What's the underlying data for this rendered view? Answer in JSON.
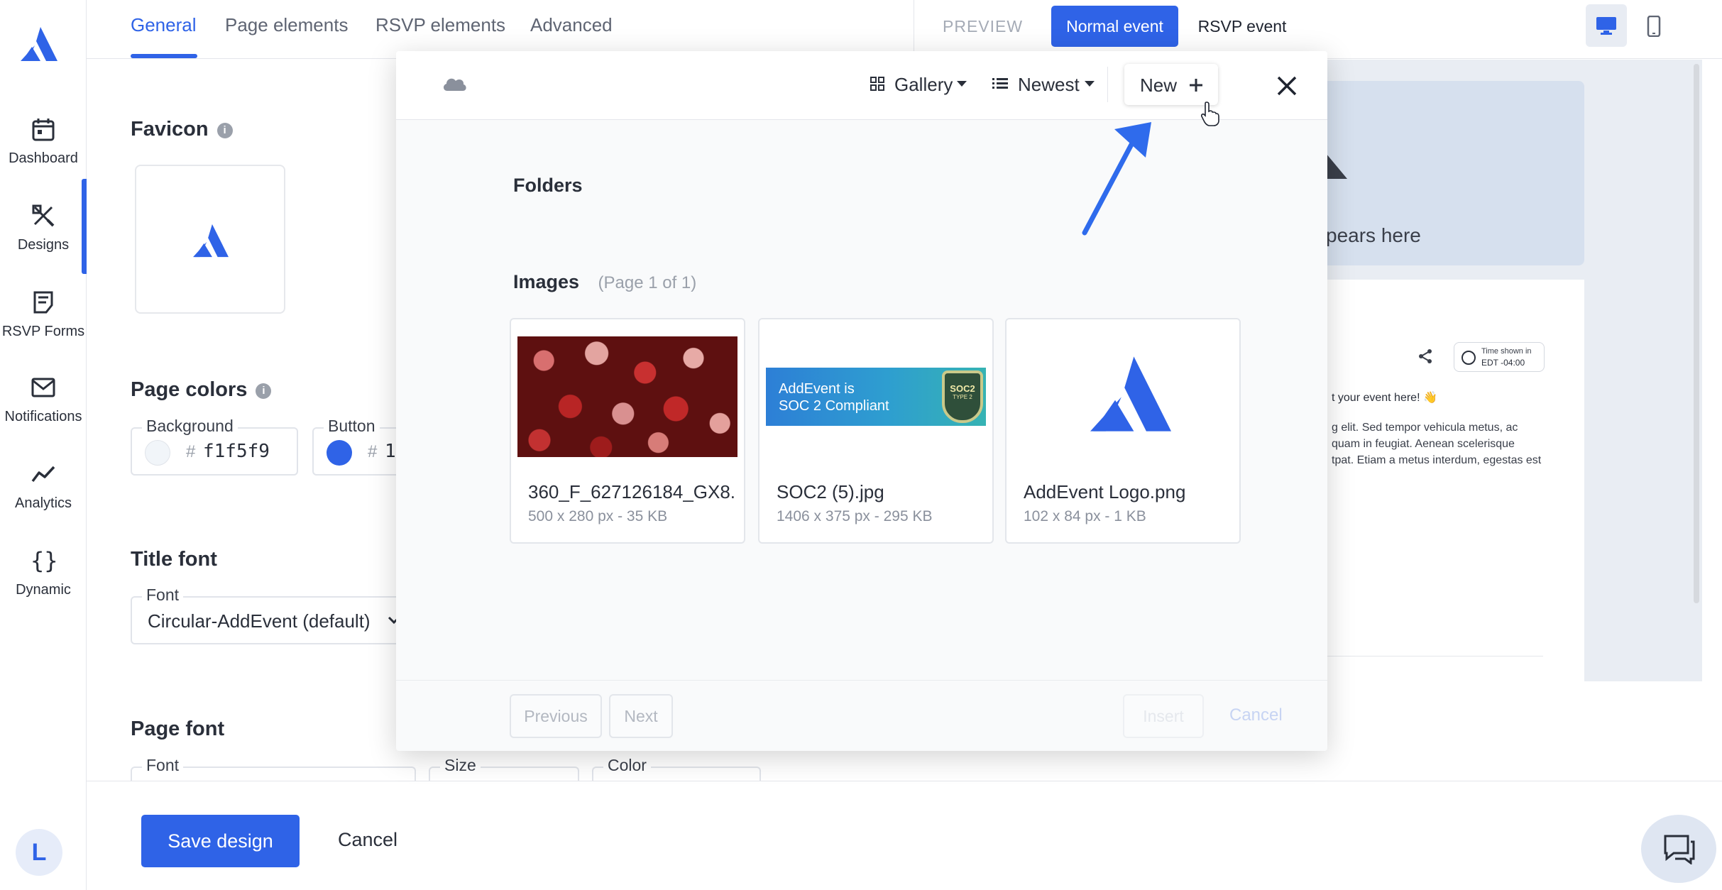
{
  "sidebar": {
    "items": [
      {
        "label": "Dashboard",
        "icon": "calendar-icon"
      },
      {
        "label": "Designs",
        "icon": "design-tools-icon"
      },
      {
        "label": "RSVP Forms",
        "icon": "form-icon"
      },
      {
        "label": "Notifications",
        "icon": "mail-icon"
      },
      {
        "label": "Analytics",
        "icon": "chart-line-icon"
      },
      {
        "label": "Dynamic",
        "icon": "braces-icon"
      }
    ],
    "avatar_initial": "L"
  },
  "tabs": [
    "General",
    "Page elements",
    "RSVP elements",
    "Advanced"
  ],
  "preview": {
    "label": "PREVIEW",
    "normal_event": "Normal event",
    "rsvp_event": "RSVP event",
    "hero_text": "pears here",
    "timezone_line1": "Time shown in",
    "timezone_line2": "EDT -04:00",
    "body_line1": "t your event here! 👋",
    "body_lines": [
      "g elit. Sed tempor vehicula metus, ac",
      "quam in feugiat. Aenean scelerisque",
      "tpat. Etiam a metus interdum, egestas est"
    ]
  },
  "form": {
    "favicon_title": "Favicon",
    "page_colors_title": "Page colors",
    "background_label": "Background",
    "background_hash": "#",
    "background_value": "f1f5f9",
    "button_label": "Button",
    "button_hash": "#",
    "button_value": "1",
    "title_font_title": "Title font",
    "title_font_label": "Font",
    "title_font_value": "Circular-AddEvent (default)",
    "page_font_title": "Page font",
    "page_font_label": "Font",
    "size_label": "Size",
    "color_label": "Color"
  },
  "footer": {
    "save_label": "Save design",
    "cancel_label": "Cancel"
  },
  "modal": {
    "gallery_label": "Gallery",
    "newest_label": "Newest",
    "new_label": "New",
    "folders_title": "Folders",
    "images_title": "Images",
    "images_page": "(Page 1 of 1)",
    "images": [
      {
        "name": "360_F_627126184_GX8...",
        "meta": "500 x 280 px - 35 KB"
      },
      {
        "name": "SOC2 (5).jpg",
        "meta": "1406 x 375 px - 295 KB",
        "banner_line1": "AddEvent is",
        "banner_line2": "SOC 2 Compliant",
        "badge_line1": "SOC2",
        "badge_line2": "TYPE 2"
      },
      {
        "name": "AddEvent Logo.png",
        "meta": "102 x 84 px - 1 KB"
      }
    ],
    "previous_label": "Previous",
    "next_label": "Next",
    "insert_label": "Insert",
    "cancel_label": "Cancel"
  },
  "colors": {
    "accent": "#2f63e7",
    "background": "#f1f5f9"
  }
}
